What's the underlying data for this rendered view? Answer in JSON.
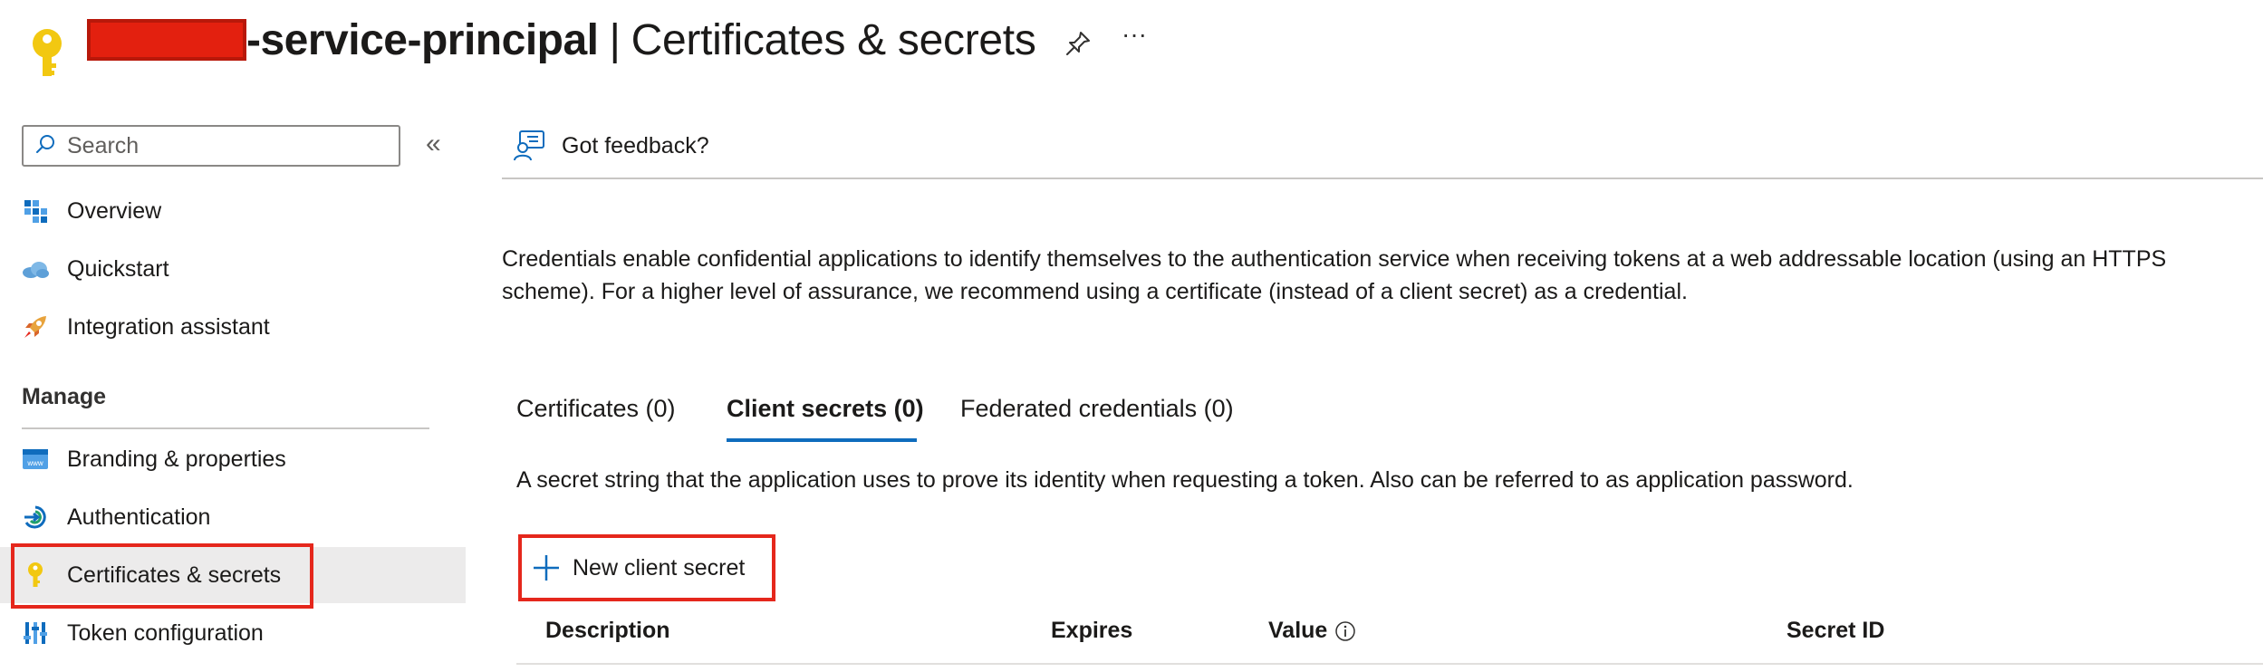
{
  "header": {
    "title_suffix": "-service-principal",
    "separator": "|",
    "section_title": "Certificates & secrets",
    "more_label": "···"
  },
  "sidebar": {
    "search_placeholder": "Search",
    "collapse_label": "«",
    "items": [
      {
        "label": "Overview",
        "icon": "overview-grid-icon"
      },
      {
        "label": "Quickstart",
        "icon": "cloud-icon"
      },
      {
        "label": "Integration assistant",
        "icon": "rocket-icon"
      }
    ],
    "manage_heading": "Manage",
    "manage_items": [
      {
        "label": "Branding & properties",
        "icon": "www-icon"
      },
      {
        "label": "Authentication",
        "icon": "authentication-icon"
      },
      {
        "label": "Certificates & secrets",
        "icon": "key-icon",
        "selected": true
      },
      {
        "label": "Token configuration",
        "icon": "token-bars-icon"
      }
    ]
  },
  "main": {
    "feedback_label": "Got feedback?",
    "description_line1": "Credentials enable confidential applications to identify themselves to the authentication service when receiving tokens at a web addressable location (using an HTTPS",
    "description_line2": "scheme). For a higher level of assurance, we recommend using a certificate (instead of a client secret) as a credential.",
    "tabs": [
      {
        "label": "Certificates (0)",
        "active": false
      },
      {
        "label": "Client secrets (0)",
        "active": true
      },
      {
        "label": "Federated credentials (0)",
        "active": false
      }
    ],
    "secret_description": "A secret string that the application uses to prove its identity when requesting a token. Also can be referred to as application password.",
    "new_secret_button": "New client secret",
    "table": {
      "columns": [
        "Description",
        "Expires",
        "Value",
        "Secret ID"
      ]
    }
  },
  "colors": {
    "accent": "#0f6cbd",
    "highlight_red": "#e5271c",
    "key_yellow": "#f2c811",
    "selected_bg": "#ecebeb"
  }
}
